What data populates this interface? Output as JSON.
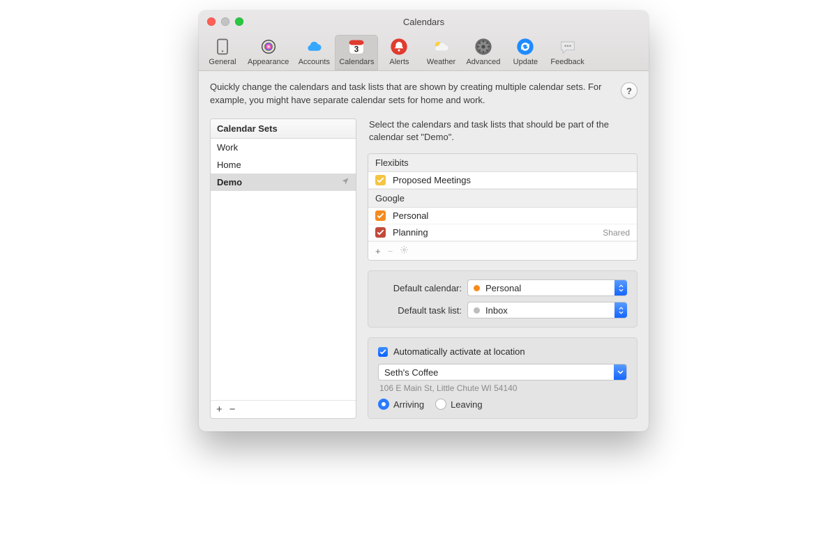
{
  "window": {
    "title": "Calendars"
  },
  "toolbar": {
    "items": [
      {
        "id": "general",
        "label": "General"
      },
      {
        "id": "appearance",
        "label": "Appearance"
      },
      {
        "id": "accounts",
        "label": "Accounts"
      },
      {
        "id": "calendars",
        "label": "Calendars"
      },
      {
        "id": "alerts",
        "label": "Alerts"
      },
      {
        "id": "weather",
        "label": "Weather"
      },
      {
        "id": "advanced",
        "label": "Advanced"
      },
      {
        "id": "update",
        "label": "Update"
      },
      {
        "id": "feedback",
        "label": "Feedback"
      }
    ],
    "active": "calendars"
  },
  "description": "Quickly change the calendars and task lists that are shown by creating multiple calendar sets. For example, you might have separate calendar sets for home and work.",
  "help_glyph": "?",
  "calendar_sets": {
    "header": "Calendar Sets",
    "items": [
      {
        "name": "Work",
        "selected": false,
        "location": false
      },
      {
        "name": "Home",
        "selected": false,
        "location": false
      },
      {
        "name": "Demo",
        "selected": true,
        "location": true
      }
    ]
  },
  "selection_info": "Select the calendars and task lists that should be part of the calendar set \"Demo\".",
  "calendars": {
    "groups": [
      {
        "name": "Flexibits",
        "items": [
          {
            "name": "Proposed Meetings",
            "checked": true,
            "color": "#f5c542",
            "tag": ""
          }
        ]
      },
      {
        "name": "Google",
        "items": [
          {
            "name": "Personal",
            "checked": true,
            "color": "#f58b1f",
            "tag": ""
          },
          {
            "name": "Planning",
            "checked": true,
            "color": "#c14a3a",
            "tag": "Shared"
          }
        ]
      }
    ]
  },
  "defaults": {
    "calendar_label": "Default calendar:",
    "calendar_value": "Personal",
    "calendar_color": "#f58b1f",
    "tasklist_label": "Default task list:",
    "tasklist_value": "Inbox",
    "tasklist_color": "#bdbdbd"
  },
  "location": {
    "checkbox_label": "Automatically activate at location",
    "value": "Seth's Coffee",
    "address": "106 E Main St, Little Chute WI 54140",
    "arriving_label": "Arriving",
    "leaving_label": "Leaving",
    "mode": "arriving"
  },
  "glyphs": {
    "plus": "+",
    "minus": "−"
  }
}
